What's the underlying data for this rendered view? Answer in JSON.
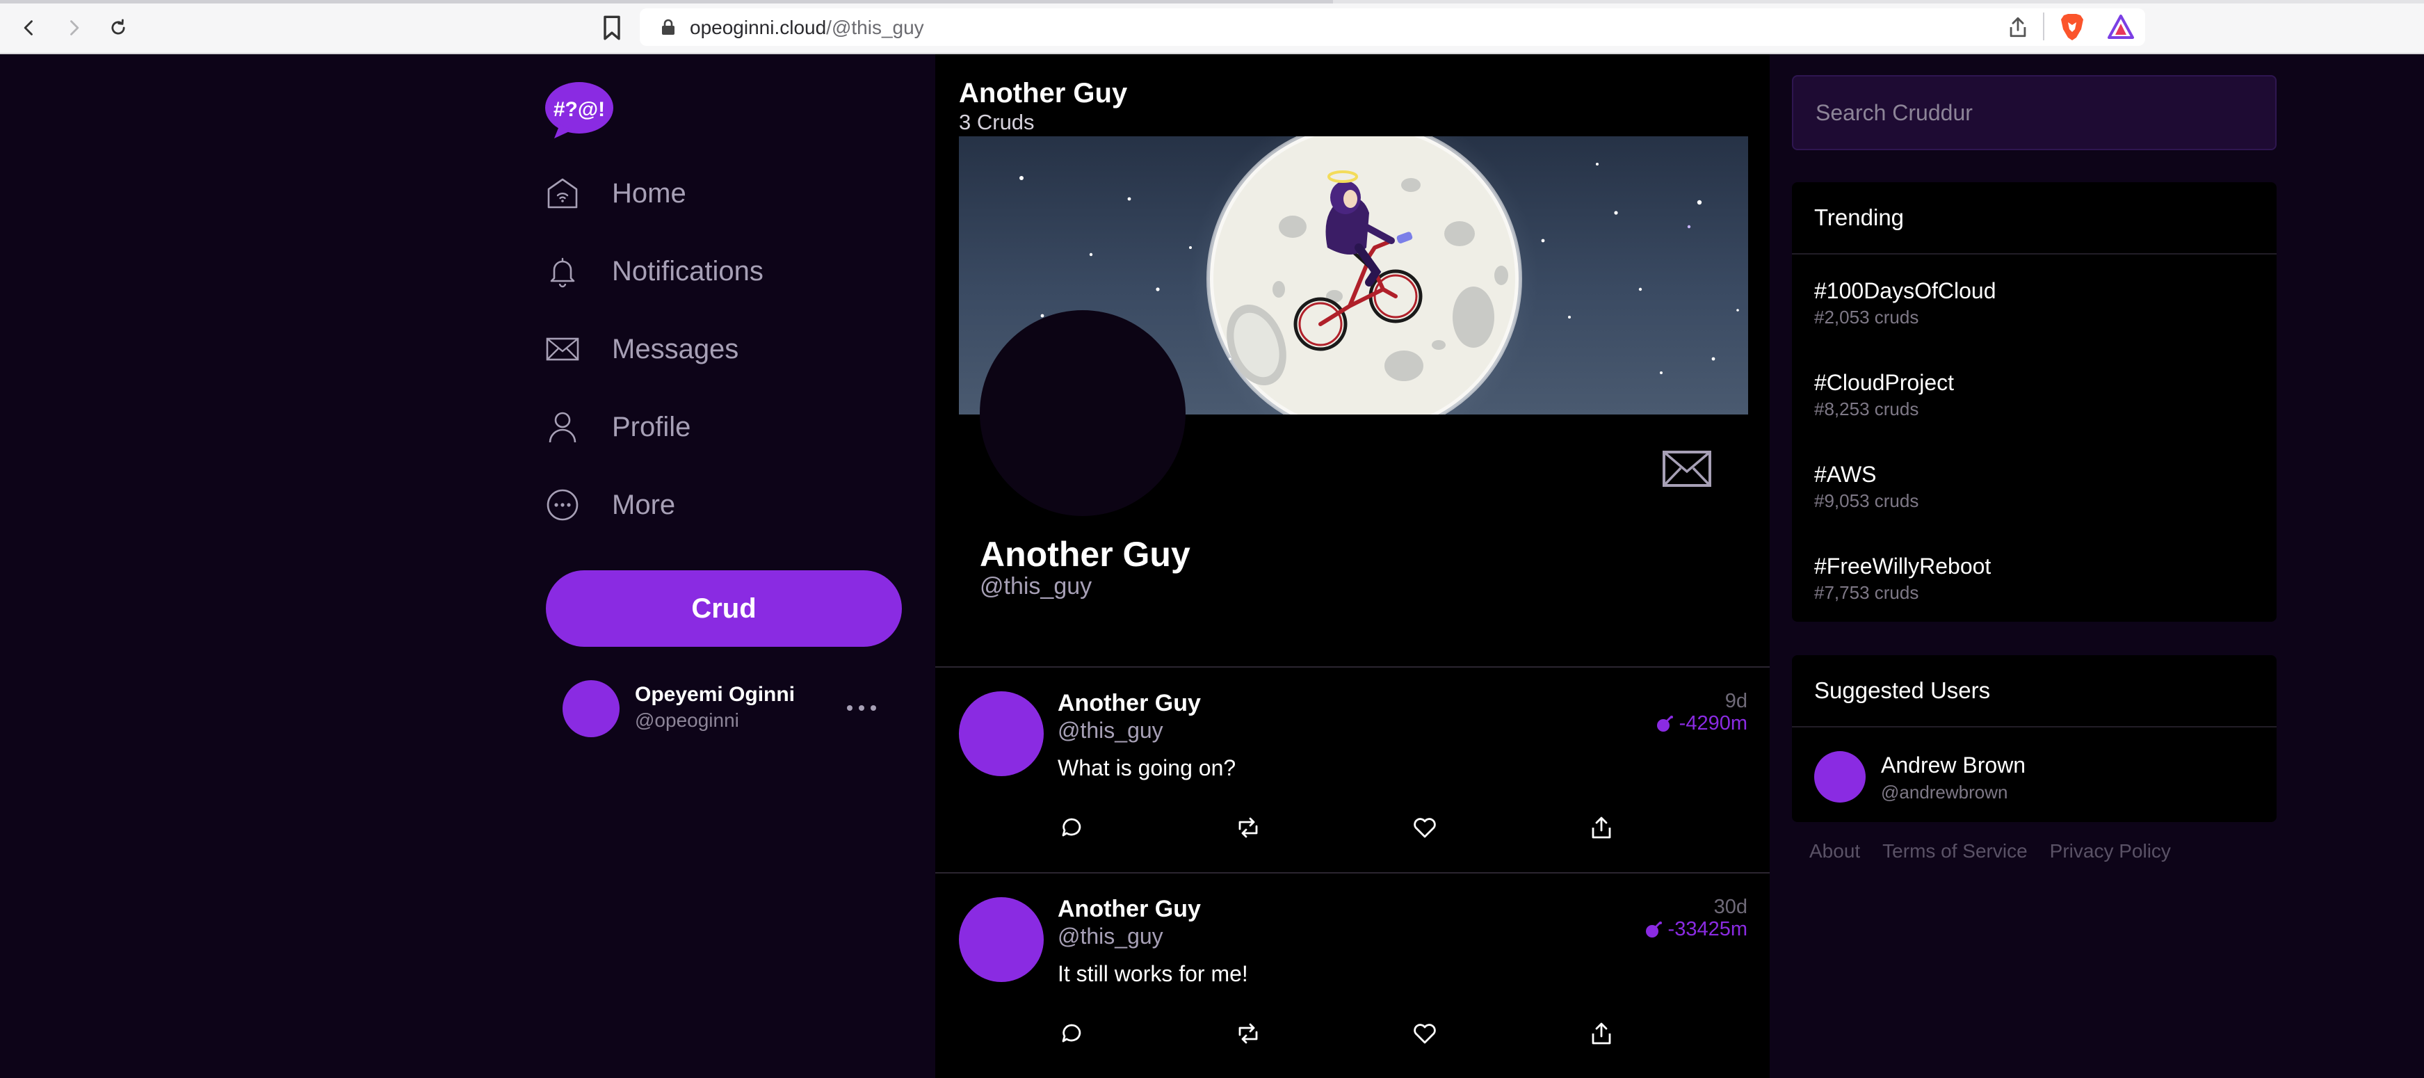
{
  "browser": {
    "url_domain": "opeoginni.cloud",
    "url_path": "/@this_guy",
    "progress": 0.55
  },
  "sidebar": {
    "logo_text": "#?@!",
    "nav": [
      {
        "label": "Home",
        "icon": "home-icon"
      },
      {
        "label": "Notifications",
        "icon": "bell-icon"
      },
      {
        "label": "Messages",
        "icon": "envelope-icon"
      },
      {
        "label": "Profile",
        "icon": "person-icon"
      },
      {
        "label": "More",
        "icon": "more-circle-icon"
      }
    ],
    "crud_button": "Crud",
    "account": {
      "name": "Opeyemi Oginni",
      "handle": "@opeoginni"
    }
  },
  "profile": {
    "title": "Another Guy",
    "cruds_count": "3 Cruds",
    "name": "Another Guy",
    "handle": "@this_guy"
  },
  "posts": [
    {
      "name": "Another Guy",
      "handle": "@this_guy",
      "body": "What is going on?",
      "time": "9d",
      "expiry": "-4290m"
    },
    {
      "name": "Another Guy",
      "handle": "@this_guy",
      "body": "It still works for me!",
      "time": "30d",
      "expiry": "-33425m"
    }
  ],
  "search": {
    "placeholder": "Search Cruddur"
  },
  "trending": {
    "title": "Trending",
    "items": [
      {
        "tag": "#100DaysOfCloud",
        "count": "#2,053 cruds"
      },
      {
        "tag": "#CloudProject",
        "count": "#8,253 cruds"
      },
      {
        "tag": "#AWS",
        "count": "#9,053 cruds"
      },
      {
        "tag": "#FreeWillyReboot",
        "count": "#7,753 cruds"
      }
    ]
  },
  "suggested": {
    "title": "Suggested Users",
    "items": [
      {
        "name": "Andrew Brown",
        "handle": "@andrewbrown"
      }
    ]
  },
  "footer": {
    "about": "About",
    "terms": "Terms of Service",
    "privacy": "Privacy Policy"
  },
  "colors": {
    "accent": "#8a2be2",
    "background": "#0d0418",
    "panel": "#000000"
  }
}
